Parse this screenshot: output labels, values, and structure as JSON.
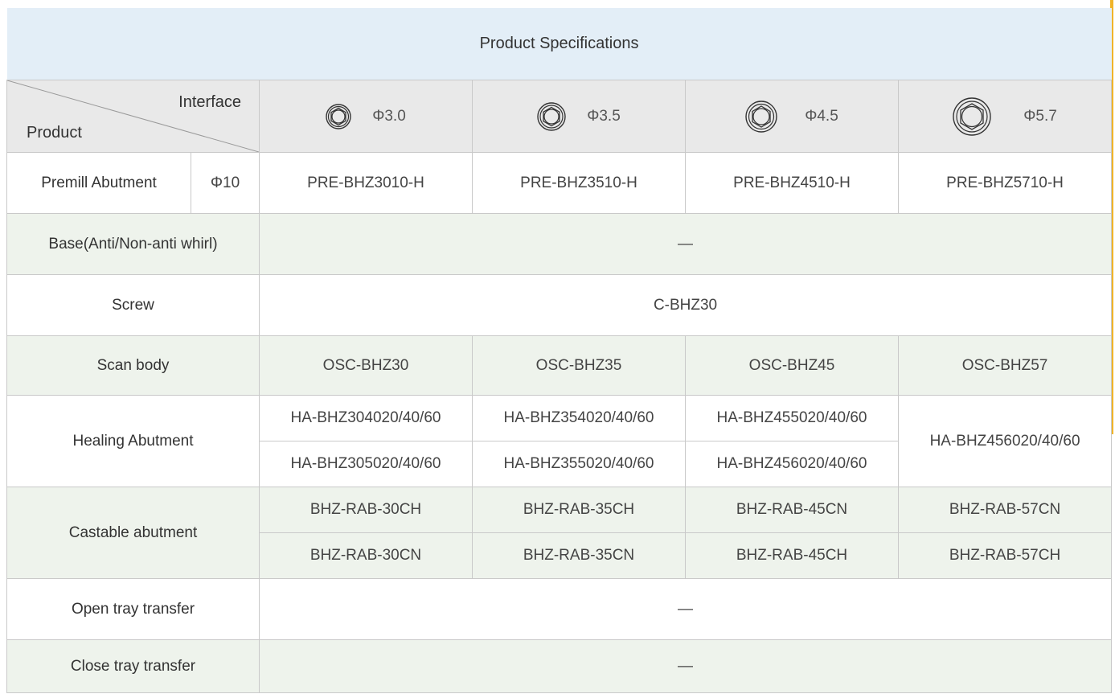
{
  "table": {
    "title": "Product Specifications",
    "header": {
      "corner_top": "Interface",
      "corner_bottom": "Product",
      "interfaces": [
        {
          "label": "Φ3.0",
          "icon": "hexagon-socket-icon"
        },
        {
          "label": "Φ3.5",
          "icon": "hexagon-socket-icon"
        },
        {
          "label": "Φ4.5",
          "icon": "hexagon-socket-icon"
        },
        {
          "label": "Φ5.7",
          "icon": "hexagon-socket-icon"
        }
      ]
    },
    "rows": {
      "premill": {
        "label": "Premill Abutment",
        "sub": "Φ10",
        "values": [
          "PRE-BHZ3010-H",
          "PRE-BHZ3510-H",
          "PRE-BHZ4510-H",
          "PRE-BHZ5710-H"
        ]
      },
      "base": {
        "label": "Base(Anti/Non-anti whirl)",
        "value": "—"
      },
      "screw": {
        "label": "Screw",
        "value": "C-BHZ30"
      },
      "scan": {
        "label": "Scan body",
        "values": [
          "OSC-BHZ30",
          "OSC-BHZ35",
          "OSC-BHZ45",
          "OSC-BHZ57"
        ]
      },
      "healing": {
        "label": "Healing Abutment",
        "row1": [
          "HA-BHZ304020/40/60",
          "HA-BHZ354020/40/60",
          "HA-BHZ455020/40/60"
        ],
        "row2": [
          "HA-BHZ305020/40/60",
          "HA-BHZ355020/40/60",
          "HA-BHZ456020/40/60"
        ],
        "merged": "HA-BHZ456020/40/60"
      },
      "castable": {
        "label": "Castable abutment",
        "row1": [
          "BHZ-RAB-30CH",
          "BHZ-RAB-35CH",
          "BHZ-RAB-45CN",
          "BHZ-RAB-57CN"
        ],
        "row2": [
          "BHZ-RAB-30CN",
          "BHZ-RAB-35CN",
          "BHZ-RAB-45CH",
          "BHZ-RAB-57CH"
        ]
      },
      "open_tray": {
        "label": "Open tray transfer",
        "value": "—"
      },
      "close_tray": {
        "label": "Close tray transfer",
        "value": "—"
      }
    }
  },
  "colors": {
    "title_bg": "#e3eef7",
    "header_bg": "#e9e9e9",
    "green_row_bg": "#eef3ec",
    "border": "#c9c9c9",
    "accent": "#f0b429"
  }
}
